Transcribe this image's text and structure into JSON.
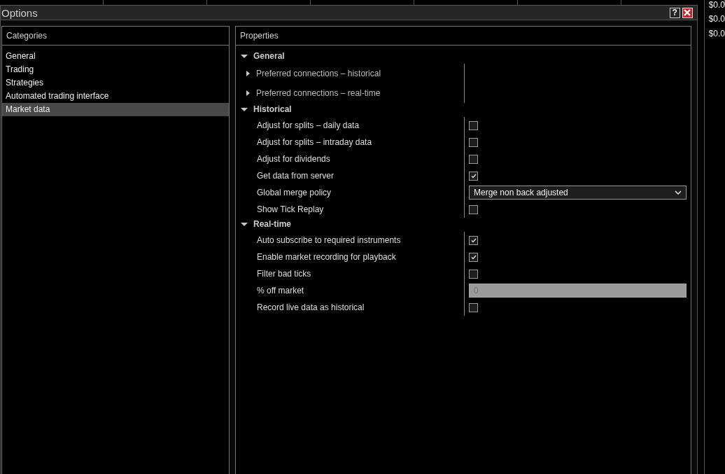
{
  "window": {
    "title": "Options",
    "help_button": "?"
  },
  "side_values": [
    "$0.0",
    "$0.0",
    "$0.0"
  ],
  "categories": {
    "header": "Categories",
    "items": [
      {
        "label": "General",
        "selected": false
      },
      {
        "label": "Trading",
        "selected": false
      },
      {
        "label": "Strategies",
        "selected": false
      },
      {
        "label": "Automated trading interface",
        "selected": false
      },
      {
        "label": "Market data",
        "selected": true
      }
    ]
  },
  "properties": {
    "header": "Properties",
    "groups": [
      {
        "label": "General",
        "expanded": true,
        "rows": [
          {
            "kind": "expander",
            "label": "Preferred connections – historical",
            "expanded": false
          },
          {
            "kind": "expander",
            "label": "Preferred connections – real-time",
            "expanded": false
          }
        ]
      },
      {
        "label": "Historical",
        "expanded": true,
        "rows": [
          {
            "kind": "checkbox",
            "label": "Adjust for splits – daily data",
            "checked": false
          },
          {
            "kind": "checkbox",
            "label": "Adjust for splits – intraday data",
            "checked": false
          },
          {
            "kind": "checkbox",
            "label": "Adjust for dividends",
            "checked": false
          },
          {
            "kind": "checkbox",
            "label": "Get data from server",
            "checked": true
          },
          {
            "kind": "dropdown",
            "label": "Global merge policy",
            "value": "Merge non back adjusted"
          },
          {
            "kind": "checkbox",
            "label": "Show Tick Replay",
            "checked": false
          }
        ]
      },
      {
        "label": "Real-time",
        "expanded": true,
        "rows": [
          {
            "kind": "checkbox",
            "label": "Auto subscribe to required instruments",
            "checked": true
          },
          {
            "kind": "checkbox",
            "label": "Enable market recording for playback",
            "checked": true
          },
          {
            "kind": "checkbox",
            "label": "Filter bad ticks",
            "checked": false
          },
          {
            "kind": "number",
            "label": "% off market",
            "value": "0",
            "disabled": true
          },
          {
            "kind": "checkbox",
            "label": "Record live data as historical",
            "checked": false
          }
        ]
      }
    ]
  }
}
